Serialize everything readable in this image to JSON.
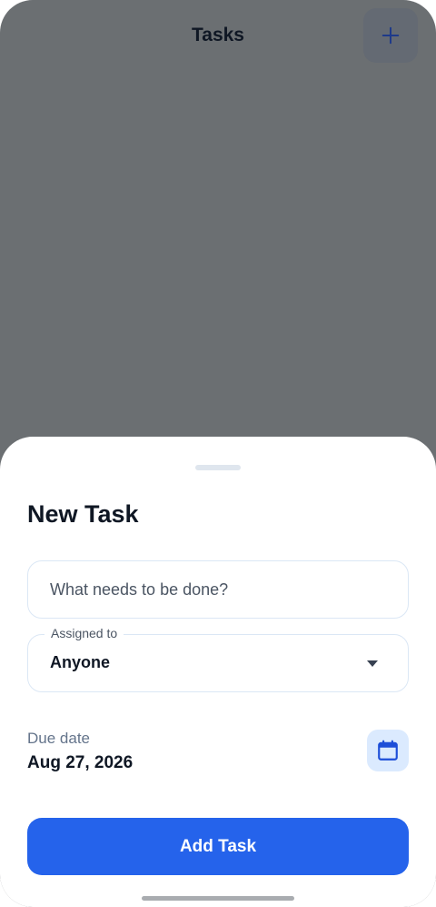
{
  "header": {
    "title": "Tasks",
    "add_icon": "plus-icon"
  },
  "sheet": {
    "title": "New Task",
    "task_input": {
      "value": "",
      "placeholder": "What needs to be done?"
    },
    "assigned": {
      "label": "Assigned to",
      "value": "Anyone",
      "icon": "chevron-down-icon"
    },
    "due": {
      "label": "Due date",
      "value": "Aug 27, 2026",
      "icon": "calendar-icon"
    },
    "submit_label": "Add Task"
  },
  "colors": {
    "accent": "#2563eb",
    "accent_light": "#dbeafe",
    "backdrop": "#6b6f72",
    "title": "#0f1724"
  }
}
